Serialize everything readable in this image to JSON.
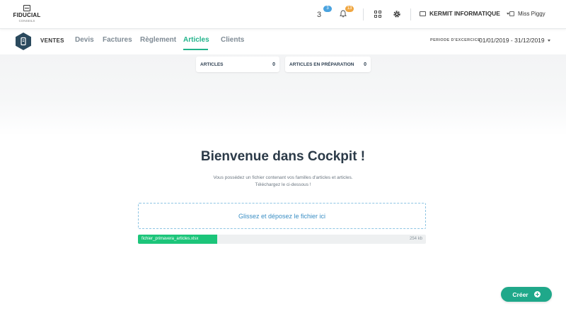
{
  "brand": {
    "name": "FIDUCIAL",
    "sub": "CONSEILS"
  },
  "topbar": {
    "messages_glyph": "3",
    "messages_badge": "3",
    "notifications_badge": "13",
    "company": "KERMIT INFORMATIQUE",
    "user": "Miss Piggy"
  },
  "nav": {
    "module": "VENTES",
    "tabs": [
      {
        "label": "Devis"
      },
      {
        "label": "Factures"
      },
      {
        "label": "Règlement"
      },
      {
        "label": "Articles",
        "active": true
      },
      {
        "label": "Clients"
      }
    ],
    "period_label": "PERIODE D'EXCERCICE",
    "period_value": "01/01/2019 - 31/12/2019"
  },
  "counters": [
    {
      "label": "ARTICLES",
      "value": "0"
    },
    {
      "label": "ARTICLES EN PRÉPARATION",
      "value": "0"
    }
  ],
  "main": {
    "title": "Bienvenue dans Cockpit !",
    "intro_line1": "Vous possédez un fichier contenant vos familles d'articles et articles.",
    "intro_line2": "Téléchargez le ci-dessous !",
    "dropzone": "Glissez et déposez le fichier ici",
    "file": {
      "name": "fichier_primavera_articles.xlsx",
      "size": "254 kb",
      "progress": 0.275
    }
  },
  "actions": {
    "create": "Créer"
  },
  "colors": {
    "accent": "#21b38a",
    "progress": "#1cc57a",
    "dropzone": "#3a8ec4"
  }
}
